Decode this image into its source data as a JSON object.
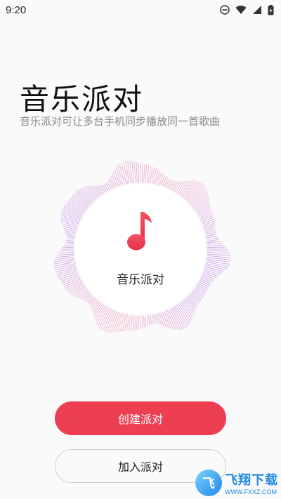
{
  "status_bar": {
    "time": "9:20"
  },
  "header": {
    "title": "音乐派对",
    "subtitle": "音乐派对可让多台手机同步播放同一首歌曲"
  },
  "center": {
    "label": "音乐派对",
    "icon": "music-note-icon",
    "accent": "#ee3e52"
  },
  "buttons": {
    "create_label": "创建派对",
    "join_label": "加入派对"
  },
  "watermark": {
    "title": "飞翔下载",
    "url": "WWW.FXXZ.COM"
  }
}
